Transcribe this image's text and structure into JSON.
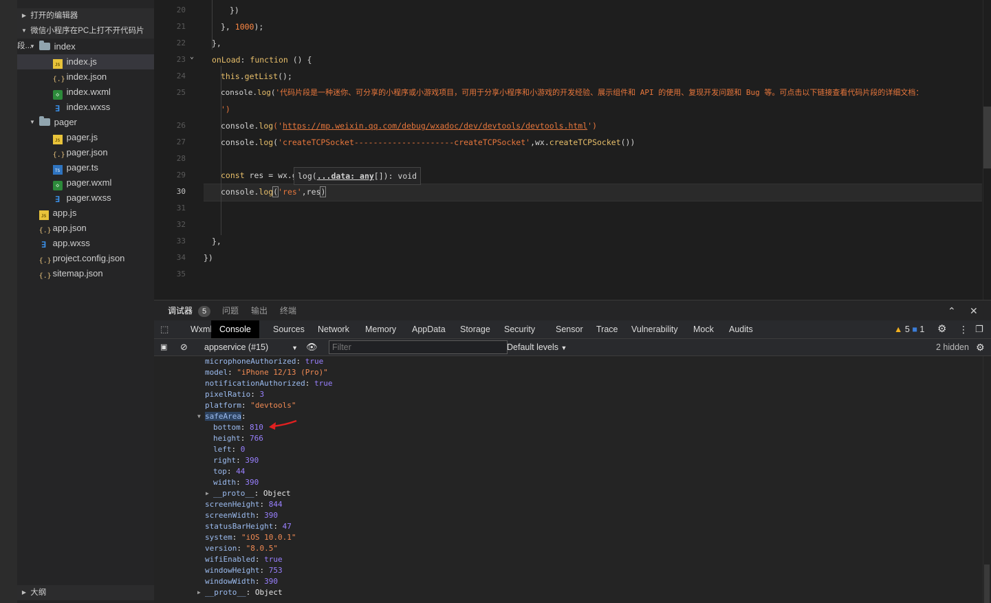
{
  "explorer": {
    "sections": {
      "open_editors": "打开的编辑器",
      "project": "微信小程序在PC上打不开代码片段...",
      "outline": "大纲"
    },
    "tree": [
      {
        "label": "index",
        "type": "folder",
        "indent": 1,
        "expanded": true
      },
      {
        "label": "index.js",
        "type": "js",
        "indent": 2,
        "selected": true
      },
      {
        "label": "index.json",
        "type": "json",
        "indent": 2
      },
      {
        "label": "index.wxml",
        "type": "wxml",
        "indent": 2
      },
      {
        "label": "index.wxss",
        "type": "wxss",
        "indent": 2
      },
      {
        "label": "pager",
        "type": "folder",
        "indent": 1,
        "expanded": true
      },
      {
        "label": "pager.js",
        "type": "js",
        "indent": 2
      },
      {
        "label": "pager.json",
        "type": "json",
        "indent": 2
      },
      {
        "label": "pager.ts",
        "type": "ts",
        "indent": 2
      },
      {
        "label": "pager.wxml",
        "type": "wxml",
        "indent": 2
      },
      {
        "label": "pager.wxss",
        "type": "wxss",
        "indent": 2
      },
      {
        "label": "app.js",
        "type": "js",
        "indent": 1
      },
      {
        "label": "app.json",
        "type": "json",
        "indent": 1
      },
      {
        "label": "app.wxss",
        "type": "wxss",
        "indent": 1
      },
      {
        "label": "project.config.json",
        "type": "json",
        "indent": 1
      },
      {
        "label": "sitemap.json",
        "type": "json",
        "indent": 1
      }
    ]
  },
  "editor": {
    "line_numbers": [
      "20",
      "21",
      "22",
      "23",
      "24",
      "25",
      "",
      "26",
      "27",
      "28",
      "29",
      "30",
      "31",
      "32",
      "33",
      "34",
      "35"
    ],
    "active_line": "30",
    "code": {
      "l20": "})",
      "l21a": "}, ",
      "l21b": "1000",
      "l21c": ");",
      "l22": "},",
      "l23a": "onLoad",
      "l23b": ": ",
      "l23c": "function",
      "l23d": " () {",
      "l24a": "this",
      "l24b": ".",
      "l24c": "getList",
      "l24d": "();",
      "l25a": "console.",
      "l25b": "log",
      "l25c": "(",
      "l25d": "'代码片段是一种迷你、可分享的小程序或小游戏项目，可用于分享小程序和小游戏的开发经验、展示组件和 API 的使用、复现开发问题和 Bug 等。可点击以下链接查看代码片段的详细文档：",
      "l25e": "')",
      "l26a": "console.",
      "l26b": "log",
      "l26c": "('",
      "l26d": "https://mp.weixin.qq.com/debug/wxadoc/dev/devtools/devtools.html",
      "l26e": "')",
      "l27a": "console.",
      "l27b": "log",
      "l27c": "(",
      "l27d": "'createTCPSocket---------------------createTCPSocket'",
      "l27e": ",wx.",
      "l27f": "createTCPSocket",
      "l27g": "())",
      "l29a": "const",
      "l29b": " res = wx.g",
      "l30a": "console.",
      "l30b": "log",
      "l30c": "(",
      "l30d": "'res'",
      "l30e": ",res",
      "l30f": ")",
      "l33": "},",
      "l34": "})"
    },
    "tooltip": {
      "a": "log(",
      "b": "...data: any",
      "c": "[]): void"
    }
  },
  "panel": {
    "tabs": [
      {
        "label": "调试器",
        "badge": "5",
        "active": true
      },
      {
        "label": "问题"
      },
      {
        "label": "输出"
      },
      {
        "label": "终端"
      }
    ],
    "devtools_tabs": [
      "Wxml",
      "Console",
      "Sources",
      "Network",
      "Memory",
      "AppData",
      "Storage",
      "Security",
      "Sensor",
      "Trace",
      "Vulnerability",
      "Mock",
      "Audits"
    ],
    "active_devtools_tab": "Console",
    "warnings": "5",
    "messages": "1",
    "context": "appservice (#15)",
    "filter_placeholder": "Filter",
    "levels": "Default levels",
    "hidden": "2 hidden",
    "console_lines": [
      {
        "key": "microphoneAuthorized",
        "value": "true",
        "vtype": "bool",
        "indent": 0
      },
      {
        "key": "model",
        "value": "\"iPhone 12/13 (Pro)\"",
        "vtype": "str",
        "indent": 0
      },
      {
        "key": "notificationAuthorized",
        "value": "true",
        "vtype": "bool",
        "indent": 0
      },
      {
        "key": "pixelRatio",
        "value": "3",
        "vtype": "num",
        "indent": 0
      },
      {
        "key": "platform",
        "value": "\"devtools\"",
        "vtype": "str",
        "indent": 0
      },
      {
        "key": "safeArea",
        "value": "",
        "vtype": "expanded",
        "indent": 0
      },
      {
        "key": "bottom",
        "value": "810",
        "vtype": "num",
        "indent": 1
      },
      {
        "key": "height",
        "value": "766",
        "vtype": "num",
        "indent": 1
      },
      {
        "key": "left",
        "value": "0",
        "vtype": "num",
        "indent": 1
      },
      {
        "key": "right",
        "value": "390",
        "vtype": "num",
        "indent": 1
      },
      {
        "key": "top",
        "value": "44",
        "vtype": "num",
        "indent": 1
      },
      {
        "key": "width",
        "value": "390",
        "vtype": "num",
        "indent": 1
      },
      {
        "key": "__proto__",
        "value": "Object",
        "vtype": "obj",
        "indent": 1
      },
      {
        "key": "screenHeight",
        "value": "844",
        "vtype": "num",
        "indent": 0
      },
      {
        "key": "screenWidth",
        "value": "390",
        "vtype": "num",
        "indent": 0
      },
      {
        "key": "statusBarHeight",
        "value": "47",
        "vtype": "num",
        "indent": 0
      },
      {
        "key": "system",
        "value": "\"iOS 10.0.1\"",
        "vtype": "str",
        "indent": 0
      },
      {
        "key": "version",
        "value": "\"8.0.5\"",
        "vtype": "str",
        "indent": 0
      },
      {
        "key": "wifiEnabled",
        "value": "true",
        "vtype": "bool",
        "indent": 0
      },
      {
        "key": "windowHeight",
        "value": "753",
        "vtype": "num",
        "indent": 0
      },
      {
        "key": "windowWidth",
        "value": "390",
        "vtype": "num",
        "indent": 0
      },
      {
        "key": "__proto__",
        "value": "Object",
        "vtype": "obj",
        "indent": 0,
        "collapsed": true
      }
    ]
  },
  "colors": {
    "keyword": "#e8bf6a",
    "string": "#e8773c",
    "console_key": "#9cbcf0",
    "console_number": "#9980ff",
    "console_string": "#f28b54",
    "annotation_arrow": "#e02020"
  },
  "icons": [
    "caret-right-icon",
    "caret-down-icon",
    "folder-icon",
    "js-file-icon",
    "json-file-icon",
    "wxml-file-icon",
    "wxss-file-icon",
    "ts-file-icon",
    "chevron-up-icon",
    "close-icon",
    "inspect-icon",
    "gear-icon",
    "more-icon",
    "undock-icon",
    "sidebar-toggle-icon",
    "clear-icon",
    "eye-icon",
    "warning-icon",
    "message-icon"
  ]
}
